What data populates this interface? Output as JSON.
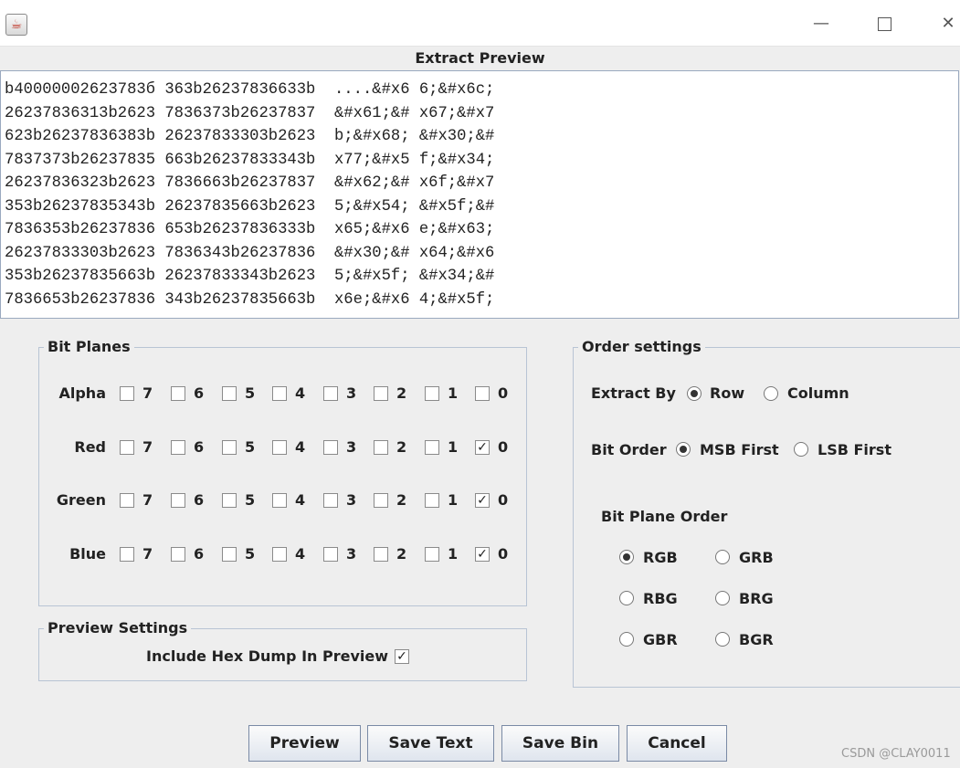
{
  "window": {
    "title": "Extract Preview",
    "minimize_glyph": "—",
    "close_glyph": "✕",
    "app_icon": "java-icon"
  },
  "preview": {
    "lines": [
      "b40000002623783б 363b26237836633b  ....&#x6 6;&#x6c;",
      "26237836313b2623 7836373b26237837  &#x61;&# x67;&#x7",
      "623b26237836383b 26237833303b2623  b;&#x68; &#x30;&#",
      "7837373b26237835 663b26237833343b  x77;&#x5 f;&#x34;",
      "26237836323b2623 7836663b26237837  &#x62;&# x6f;&#x7",
      "353b26237835343b 26237835663b2623  5;&#x54; &#x5f;&#",
      "7836353b26237836 653b26237836333b  x65;&#x6 e;&#x63;",
      "26237833303b2623 7836343b26237836  &#x30;&# x64;&#x6",
      "353b26237835663b 26237833343b2623  5;&#x5f; &#x34;&#",
      "7836653b26237836 343b26237835663b  x6e;&#x6 4;&#x5f;"
    ]
  },
  "bit_planes": {
    "title": "Bit Planes",
    "bits": [
      "7",
      "6",
      "5",
      "4",
      "3",
      "2",
      "1",
      "0"
    ],
    "channels": [
      {
        "label": "Alpha",
        "checked": [
          false,
          false,
          false,
          false,
          false,
          false,
          false,
          false
        ]
      },
      {
        "label": "Red",
        "checked": [
          false,
          false,
          false,
          false,
          false,
          false,
          false,
          true
        ]
      },
      {
        "label": "Green",
        "checked": [
          false,
          false,
          false,
          false,
          false,
          false,
          false,
          true
        ]
      },
      {
        "label": "Blue",
        "checked": [
          false,
          false,
          false,
          false,
          false,
          false,
          false,
          true
        ]
      }
    ]
  },
  "preview_settings": {
    "title": "Preview Settings",
    "hex_dump_label": "Include Hex Dump In Preview",
    "hex_dump_checked": true
  },
  "order_settings": {
    "title": "Order settings",
    "extract_by_label": "Extract By",
    "extract_by_options": [
      "Row",
      "Column"
    ],
    "extract_by_selected": "Row",
    "bit_order_label": "Bit Order",
    "bit_order_options": [
      "MSB First",
      "LSB First"
    ],
    "bit_order_selected": "MSB First",
    "bit_plane_order_label": "Bit Plane Order",
    "bit_plane_order_options": [
      "RGB",
      "GRB",
      "RBG",
      "BRG",
      "GBR",
      "BGR"
    ],
    "bit_plane_order_selected": "RGB"
  },
  "buttons": {
    "preview": "Preview",
    "save_text": "Save Text",
    "save_bin": "Save Bin",
    "cancel": "Cancel"
  },
  "watermark": "CSDN @CLAY0011"
}
